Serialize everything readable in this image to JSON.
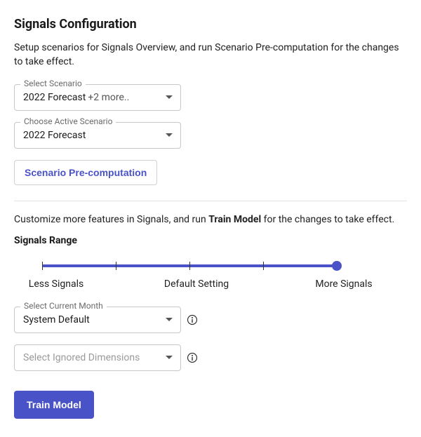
{
  "page": {
    "title": "Signals Configuration",
    "subtitle": "Setup scenarios for Signals Overview, and run Scenario Pre-computation for the changes to take effect."
  },
  "selectScenario": {
    "label": "Select Scenario",
    "value": "2022 Forecast",
    "extra": "+2 more.."
  },
  "activeScenario": {
    "label": "Choose Active Scenario",
    "value": "2022 Forecast"
  },
  "buttons": {
    "precompute": "Scenario Pre-computation",
    "train": "Train Model"
  },
  "section2": {
    "intro_pre": "Customize more features in Signals, and run ",
    "intro_bold": "Train Model",
    "intro_post": " for the changes to take effect.",
    "range_heading": "Signals Range"
  },
  "slider": {
    "left": "Less Signals",
    "mid": "Default Setting",
    "right": "More Signals"
  },
  "currentMonth": {
    "label": "Select Current Month",
    "value": "System Default"
  },
  "ignoredDims": {
    "placeholder": "Select Ignored Dimensions"
  }
}
